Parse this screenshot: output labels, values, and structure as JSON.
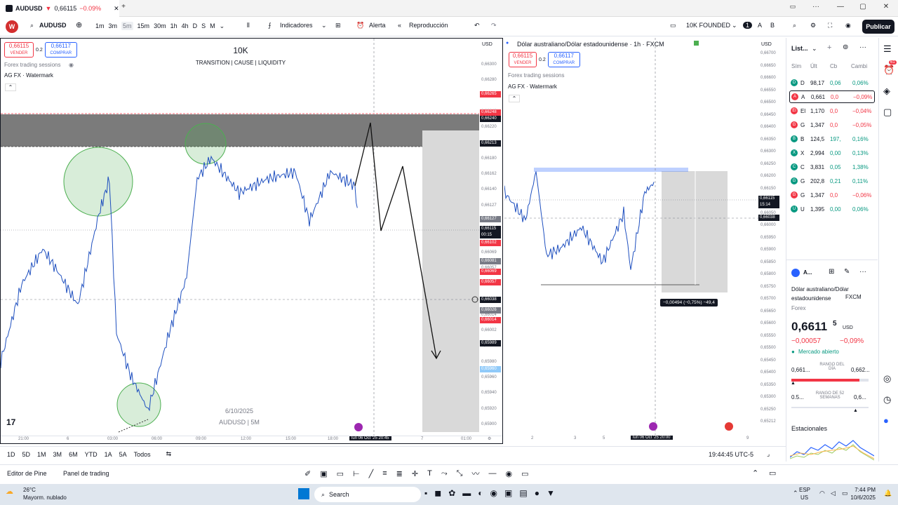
{
  "titlebar": {
    "tab_title": "AUDUSD",
    "tab_price": "0,66115",
    "tab_change": "−0.09%",
    "close": "✕",
    "new_tab": "+",
    "minimize": "—",
    "maximize": "▢",
    "close_win": "✕"
  },
  "toolbar": {
    "symbol": "AUDUSD",
    "intervals": [
      "1m",
      "3m",
      "5m",
      "15m",
      "30m",
      "1h",
      "4h",
      "D",
      "S",
      "M"
    ],
    "selected_interval": "5m",
    "indicators": "Indicadores",
    "alert": "Alerta",
    "replay": "Reproducción",
    "layout_name": "10K FOUNDED",
    "account_num": "1",
    "publish": "Publicar",
    "avatar": "W"
  },
  "left_chart": {
    "sell_price": "0,66115",
    "sell_label": "VENDER",
    "spread": "0.2",
    "buy_price": "0,66117",
    "buy_label": "COMPRAR",
    "currency": "USD",
    "header_title": "10K",
    "header_sub": "TRANSITION |  CAUSE  | LIQUIDITY",
    "indicator1": "Forex trading sessions",
    "indicator2": "AG FX · Watermark",
    "watermark_date": "6/10/2025",
    "watermark_sym": "AUDUSD | 5M",
    "price_labels": [
      "0,66300",
      "0,66280",
      "0,66261",
      "0,66240",
      "0,66220",
      "0,66200",
      "0,66180",
      "0,66162",
      "0,66140",
      "0,66127",
      "0,66102",
      "0,66081",
      "0,66069",
      "0,66057",
      "0,66038",
      "0,66026",
      "0,66014",
      "0,66002",
      "0,65989",
      "0,65980",
      "0,65960",
      "0,65940",
      "0,65920",
      "0,65900"
    ],
    "tags": {
      "t1": "0,66265",
      "t2": "0,66248",
      "t3": "0,66240",
      "t4": "0,66213",
      "t5": "0,66127",
      "t6": "0,66115",
      "t6b": "00:15",
      "t7": "0,66102",
      "t8": "0,66081",
      "t9": "0,66069",
      "t10": "0,66057",
      "t11": "0,66038",
      "t12": "0,66026",
      "t13": "0,66014",
      "t14": "0,65989",
      "t15": "0,65960"
    },
    "x_labels": [
      "21:00",
      "6",
      "03:00",
      "06:00",
      "09:00",
      "12:00",
      "15:00",
      "18:00",
      "7",
      "01:00"
    ],
    "cursor_time": "lun 06 Oct '25  20:45"
  },
  "right_chart": {
    "title": "Dólar australiano/Dólar estadounidense · 1h · FXCM",
    "sell_price": "0,66115",
    "sell_label": "VENDER",
    "spread": "0.2",
    "buy_price": "0,66117",
    "buy_label": "COMPRAR",
    "currency": "USD",
    "indicator1": "Forex trading sessions",
    "indicator2": "AG FX · Watermark",
    "price_labels": [
      "0,66700",
      "0,66650",
      "0,66600",
      "0,66550",
      "0,66500",
      "0,66450",
      "0,66400",
      "0,66350",
      "0,66300",
      "0,66250",
      "0,66200",
      "0,66150",
      "0,66100",
      "0,66050",
      "0,66000",
      "0,65950",
      "0,65900",
      "0,65850",
      "0,65800",
      "0,65750",
      "0,65700",
      "0,65650",
      "0,65600",
      "0,65550",
      "0,65500",
      "0,65450",
      "0,65400",
      "0,65350",
      "0,65300",
      "0,65250",
      "0,65212"
    ],
    "tag_price": "0,66115",
    "tag_time": "15:14",
    "tag_price2": "0,66038",
    "measure": "−0,00494 (−0,75%) −49,4",
    "x_labels": [
      "2",
      "3",
      "5",
      "9"
    ],
    "cursor_time": "lun 06 Oct '25  20:00"
  },
  "watchlist": {
    "title": "List...",
    "cols": [
      "Sím",
      "Últ",
      "Cb",
      "Cambi"
    ],
    "rows": [
      {
        "s": "D",
        "l": "98,17",
        "c": "0,06",
        "p": "0,06%",
        "col": "#089981"
      },
      {
        "s": "A",
        "l": "0,661",
        "c": "0,0",
        "p": "−0,09%",
        "col": "#f23645"
      },
      {
        "s": "El",
        "l": "1,170",
        "c": "0,0",
        "p": "−0,04%",
        "col": "#f23645"
      },
      {
        "s": "G",
        "l": "1,347",
        "c": "0,0",
        "p": "−0,05%",
        "col": "#f23645"
      },
      {
        "s": "B",
        "l": "124,5",
        "c": "197,",
        "p": "0,16%",
        "col": "#089981"
      },
      {
        "s": "X",
        "l": "2,994",
        "c": "0,00",
        "p": "0,13%",
        "col": "#089981"
      },
      {
        "s": "C",
        "l": "3,831",
        "c": "0,05",
        "p": "1,38%",
        "col": "#089981"
      },
      {
        "s": "G",
        "l": "202,8",
        "c": "0,21",
        "p": "0,11%",
        "col": "#089981"
      },
      {
        "s": "G",
        "l": "1,347",
        "c": "0,0",
        "p": "−0,06%",
        "col": "#f23645"
      },
      {
        "s": "U",
        "l": "1,395",
        "c": "0,00",
        "p": "0,06%",
        "col": "#089981"
      }
    ]
  },
  "details": {
    "sym": "A...",
    "name": "Dólar australiano/Dólar estadounidense",
    "exchange": "FXCM",
    "type": "Forex",
    "price": "0,6611",
    "price_sup": "5",
    "currency": "USD",
    "change": "−0,00057",
    "change_pct": "−0,09%",
    "status": "Mercado abierto",
    "day_low": "0,661...",
    "day_range": "RANGO DEL DÍA",
    "day_high": "0,662...",
    "w52_low": "0.5...",
    "w52_range": "RANGO DE 52 SEMANAS",
    "w52_high": "0,6...",
    "seasonal": "Estacionales"
  },
  "bottombar": {
    "ranges": [
      "1D",
      "5D",
      "1M",
      "3M",
      "6M",
      "YTD",
      "1A",
      "5A",
      "Todos"
    ],
    "clock": "19:44:45 UTC-5"
  },
  "bottom2": {
    "pine": "Editor de Pine",
    "panel": "Panel de trading"
  },
  "taskbar": {
    "temp": "26°C",
    "weather": "Mayorm. nublado",
    "search": "Search",
    "lang1": "ESP",
    "lang2": "US",
    "time": "7:44 PM",
    "date": "10/6/2025"
  },
  "notif_count": "61"
}
